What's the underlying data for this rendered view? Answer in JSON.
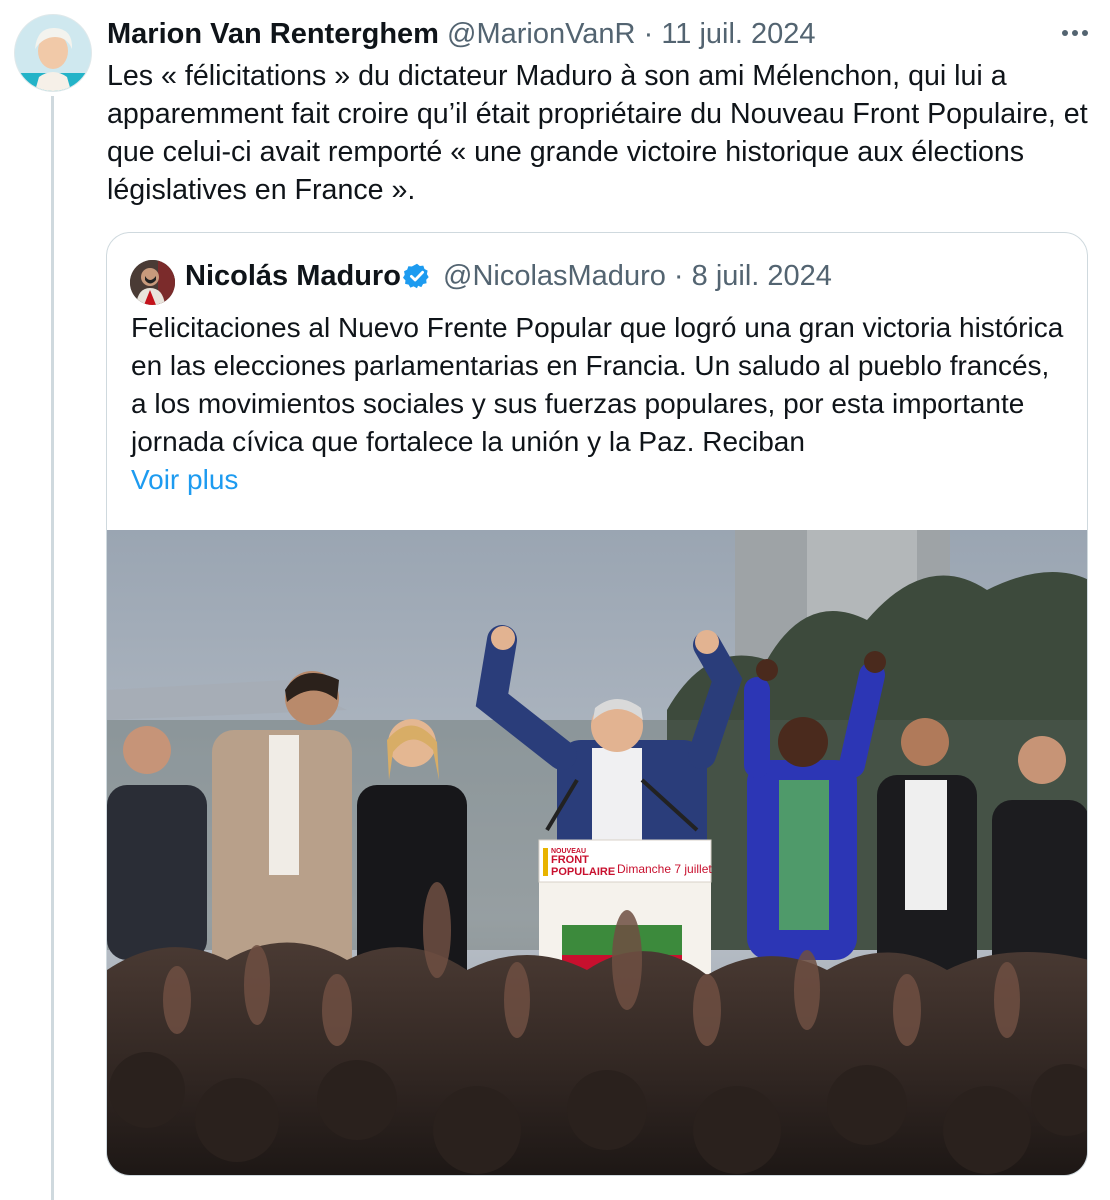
{
  "post": {
    "author_name": "Marion Van Renterghem",
    "handle": "@MarionVanR",
    "separator": "·",
    "date": "11 juil. 2024",
    "text": "Les « félicitations » du dictateur Maduro  à son ami Mélenchon, qui lui a apparemment fait croire qu’il était propriétaire du Nouveau Front Populaire, et que celui-ci avait remporté « une grande victoire historique aux élections législatives en France »."
  },
  "quoted": {
    "author_name": "Nicolás Maduro",
    "handle": "@NicolasMaduro",
    "separator": "·",
    "date": "8 juil. 2024",
    "text": "Felicitaciones al Nuevo Frente Popular que logró una gran victoria histórica en las elecciones parlamentarias en Francia. Un saludo al pueblo francés, a los movimientos sociales y sus fuerzas populares, por esta importante jornada cívica que fortalece la unión y la Paz. Reciban",
    "see_more": "Voir plus",
    "podium": {
      "line1": "NOUVEAU",
      "line2": "FRONT",
      "line3": "POPULAIRE",
      "date_label": "Dimanche 7 juillet"
    }
  },
  "icons": {
    "more": "more-horizontal-icon",
    "verified": "verified-badge-icon"
  },
  "colors": {
    "link": "#1d9bf0",
    "muted": "#536471",
    "border": "#cfd9de",
    "verified": "#1d9bf0",
    "podium_red": "#c8102e"
  }
}
